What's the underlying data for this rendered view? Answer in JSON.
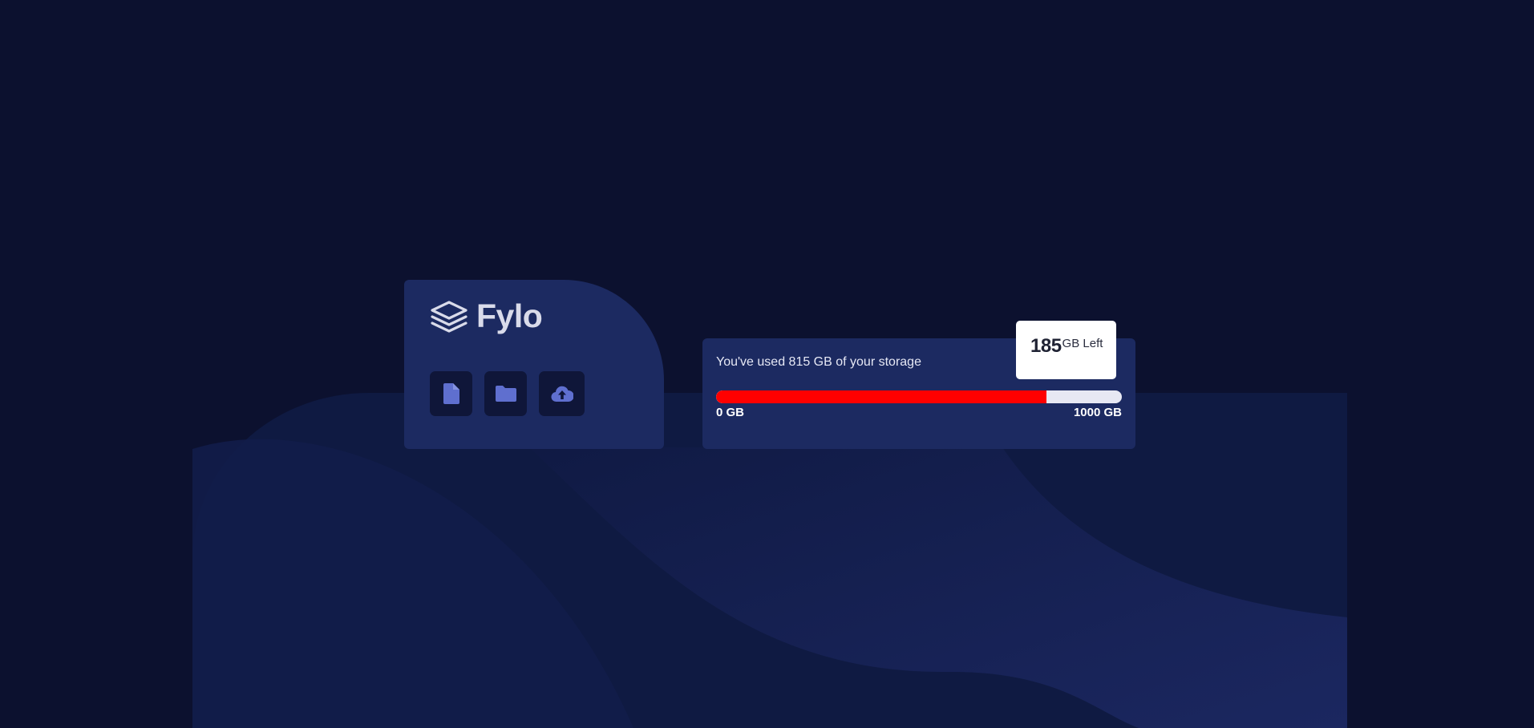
{
  "brand": {
    "name": "Fylo",
    "logo_icon": "layers-icon"
  },
  "actions": [
    {
      "icon": "document-icon"
    },
    {
      "icon": "folder-icon"
    },
    {
      "icon": "upload-icon"
    }
  ],
  "storage": {
    "usage_text": "You've used 815 GB of your storage",
    "used_fraction": 0.815,
    "min_label": "0 GB",
    "max_label": "1000 GB",
    "remaining_number": "185",
    "remaining_unit": "GB Left"
  },
  "colors": {
    "page_background": "#0c112f",
    "card_background": "#1c2a61",
    "icon_tile": "#0f1639",
    "progress_fill": "#ff0000",
    "progress_track": "#e7e8f3",
    "icon_accent": "#5f6fcf"
  }
}
